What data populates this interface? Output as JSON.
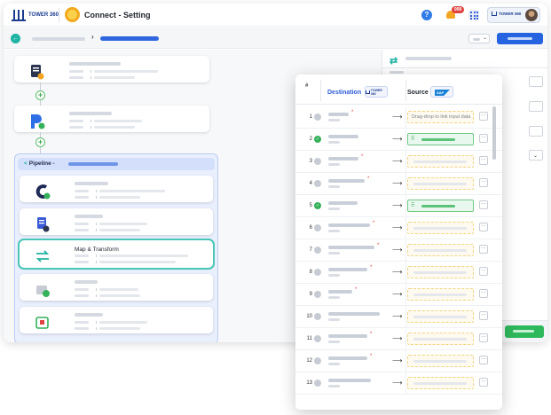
{
  "header": {
    "brand": "TOWER 360",
    "app_title": "Connect - Setting",
    "notification_count": "999",
    "user_brand": "TOWER 360"
  },
  "canvas": {
    "pipeline_label": "Pipeline -",
    "selected_step_label": "Map & Transform"
  },
  "mapping": {
    "header_hash": "#",
    "destination_label": "Destination",
    "source_label": "Source",
    "source_system": "SAP",
    "drop_placeholder": "Drag-drop to link input data",
    "rows": [
      {
        "num": "1",
        "status": "pending",
        "required": true,
        "linked": false,
        "placeholder": true
      },
      {
        "num": "2",
        "status": "ok",
        "required": false,
        "linked": true
      },
      {
        "num": "3",
        "status": "pending",
        "required": true,
        "linked": false
      },
      {
        "num": "4",
        "status": "pending",
        "required": true,
        "linked": false
      },
      {
        "num": "5",
        "status": "ok",
        "required": false,
        "linked": true
      },
      {
        "num": "6",
        "status": "pending",
        "required": true,
        "linked": false
      },
      {
        "num": "7",
        "status": "pending",
        "required": true,
        "linked": false
      },
      {
        "num": "8",
        "status": "pending",
        "required": true,
        "linked": false
      },
      {
        "num": "9",
        "status": "pending",
        "required": true,
        "linked": false
      },
      {
        "num": "10",
        "status": "pending",
        "required": false,
        "linked": false
      },
      {
        "num": "11",
        "status": "pending",
        "required": true,
        "linked": false
      },
      {
        "num": "12",
        "status": "pending",
        "required": true,
        "linked": false
      },
      {
        "num": "13",
        "status": "pending",
        "required": false,
        "linked": false
      }
    ]
  }
}
